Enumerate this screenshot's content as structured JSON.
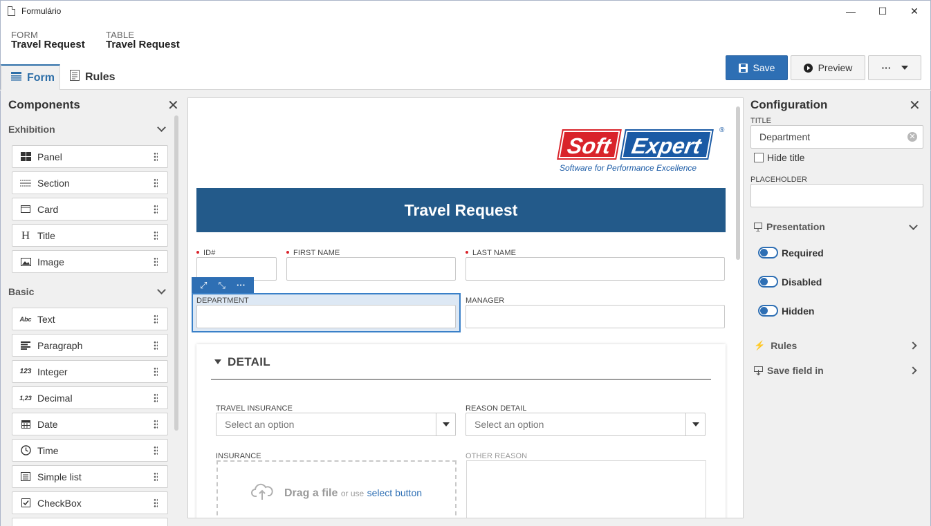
{
  "window": {
    "title": "Formulário",
    "minimize": "—",
    "maximize": "☐",
    "close": "✕"
  },
  "header": {
    "form_label": "FORM",
    "form_value": "Travel Request",
    "table_label": "TABLE",
    "table_value": "Travel Request"
  },
  "tabs": [
    {
      "label": "Form",
      "icon": "form-icon"
    },
    {
      "label": "Rules",
      "icon": "rules-icon"
    }
  ],
  "toolbar": {
    "save_label": "Save",
    "preview_label": "Preview",
    "more_label": "···"
  },
  "components": {
    "title": "Components",
    "groups": [
      {
        "label": "Exhibition",
        "items": [
          {
            "label": "Panel",
            "icon": "panel-icon"
          },
          {
            "label": "Section",
            "icon": "section-icon"
          },
          {
            "label": "Card",
            "icon": "card-icon"
          },
          {
            "label": "Title",
            "icon": "title-icon",
            "glyph": "H"
          },
          {
            "label": "Image",
            "icon": "image-icon"
          }
        ]
      },
      {
        "label": "Basic",
        "items": [
          {
            "label": "Text",
            "icon": "text-icon",
            "glyph": "Abc"
          },
          {
            "label": "Paragraph",
            "icon": "paragraph-icon"
          },
          {
            "label": "Integer",
            "icon": "integer-icon",
            "glyph": "123"
          },
          {
            "label": "Decimal",
            "icon": "decimal-icon",
            "glyph": "1,23"
          },
          {
            "label": "Date",
            "icon": "date-icon"
          },
          {
            "label": "Time",
            "icon": "time-icon"
          },
          {
            "label": "Simple list",
            "icon": "list-icon"
          },
          {
            "label": "CheckBox",
            "icon": "checkbox-icon"
          }
        ]
      }
    ]
  },
  "canvas": {
    "logo": {
      "soft": "Soft",
      "expert": "Expert",
      "tagline": "Software for Performance Excellence",
      "reg": "®"
    },
    "form_title": "Travel Request",
    "fields": {
      "id": "ID#",
      "first_name": "FIRST NAME",
      "last_name": "LAST NAME",
      "department": "DEPARTMENT",
      "manager": "MANAGER"
    },
    "section": {
      "title": "DETAIL",
      "travel_insurance": "TRAVEL INSURANCE",
      "travel_insurance_placeholder": "Select an option",
      "reason_detail": "REASON DETAIL",
      "reason_detail_placeholder": "Select an option",
      "insurance": "INSURANCE",
      "other_reason": "OTHER REASON",
      "drop_main": "Drag a file",
      "drop_or": "or use",
      "drop_link": "select button"
    }
  },
  "configuration": {
    "title": "Configuration",
    "title_label": "TITLE",
    "title_value": "Department",
    "hide_title": "Hide title",
    "placeholder_label": "PLACEHOLDER",
    "placeholder_value": "",
    "presentation": "Presentation",
    "toggles": [
      {
        "label": "Required",
        "on": false
      },
      {
        "label": "Disabled",
        "on": false
      },
      {
        "label": "Hidden",
        "on": false
      }
    ],
    "rules": "Rules",
    "save_field_in": "Save field in"
  },
  "colors": {
    "accent": "#2e6fb4",
    "banner": "#235a8a",
    "required": "#d9232a"
  }
}
